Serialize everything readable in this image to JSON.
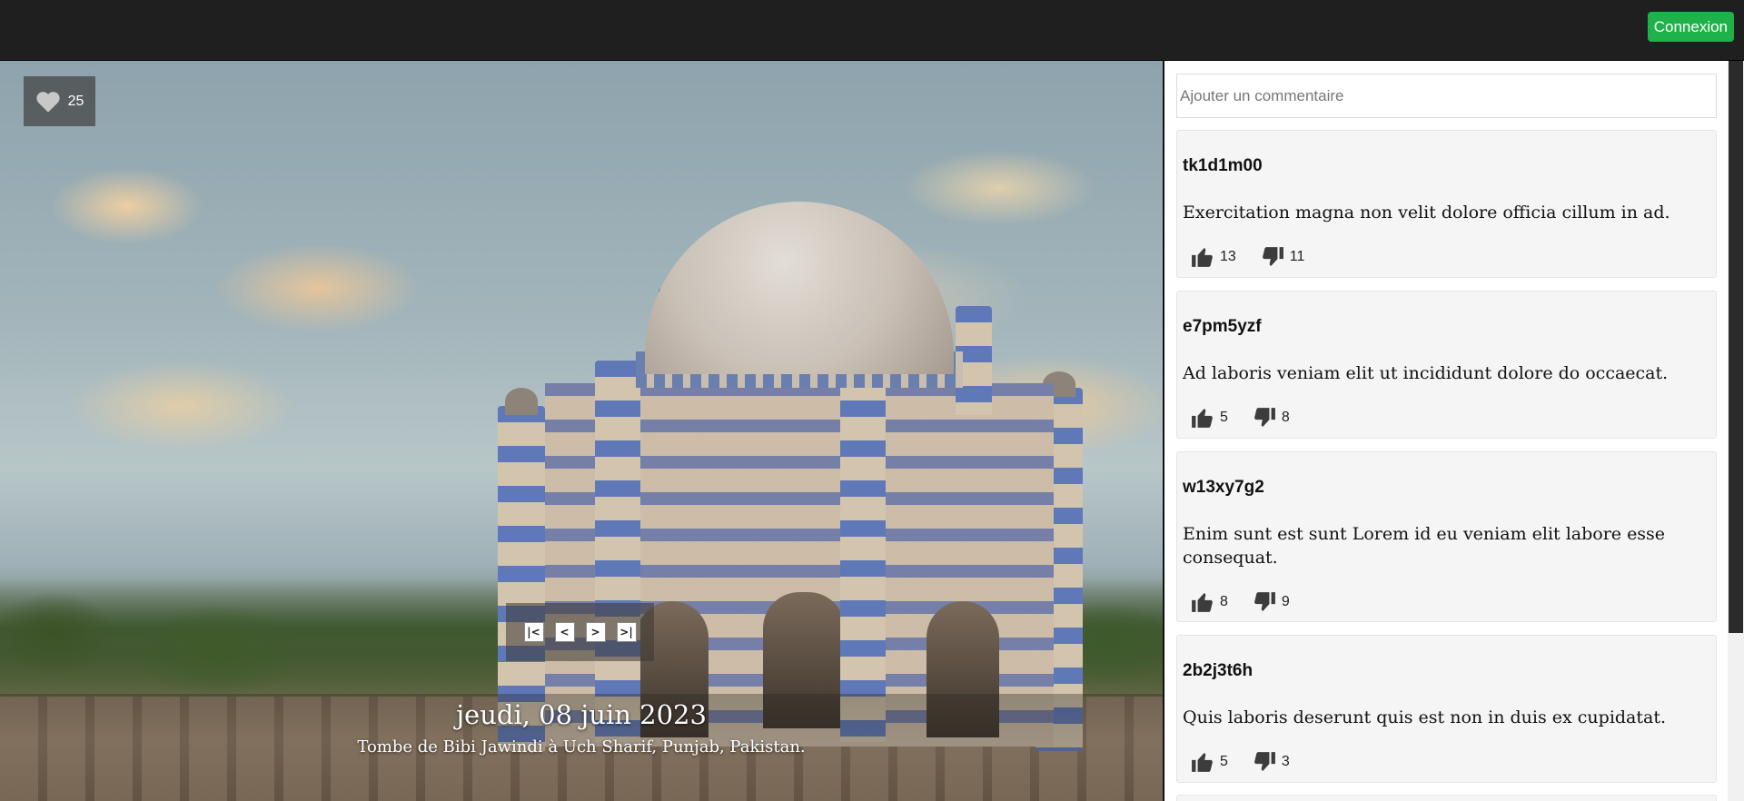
{
  "header": {
    "login_label": "Connexion"
  },
  "photo": {
    "like_count": "25",
    "date": "jeudi, 08 juin 2023",
    "description": "Tombe de Bibi Jawindi à Uch Sharif, Punjab, Pakistan.",
    "nav": {
      "first": "|<",
      "prev": "<",
      "next": ">",
      "last": ">|"
    }
  },
  "comment_input": {
    "placeholder": "Ajouter un commentaire"
  },
  "comments": [
    {
      "author": "tk1d1m00",
      "text": "Exercitation magna non velit dolore officia cillum in ad.",
      "likes": "13",
      "dislikes": "11"
    },
    {
      "author": "e7pm5yzf",
      "text": "Ad laboris veniam elit ut incididunt dolore do occaecat.",
      "likes": "5",
      "dislikes": "8"
    },
    {
      "author": "w13xy7g2",
      "text": "Enim sunt est sunt Lorem id eu veniam elit labore esse consequat.",
      "likes": "8",
      "dislikes": "9"
    },
    {
      "author": "2b2j3t6h",
      "text": "Quis laboris deserunt quis est non in duis ex cupidatat.",
      "likes": "5",
      "dislikes": "3"
    }
  ],
  "colors": {
    "accent": "#1fb24a",
    "topbar": "#1f1f1f",
    "card": "#f5f5f5"
  }
}
